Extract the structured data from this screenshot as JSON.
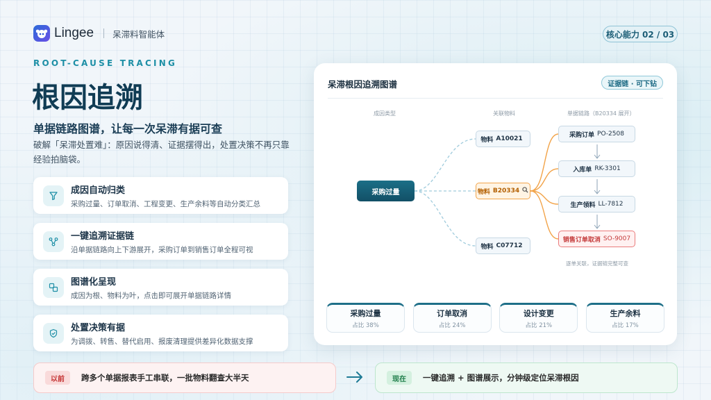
{
  "header": {
    "brand": "Lingee",
    "product": "呆滞料智能体",
    "page_badge": "核心能力 02 / 03"
  },
  "hero": {
    "eyebrow": "ROOT-CAUSE TRACING",
    "title": "根因追溯",
    "subtitle": "单据链路图谱，让每一次呆滞有据可查",
    "description": "破解「呆滞处置难」：原因说得清、证据摆得出，处置决策不再只靠经验拍脑袋。"
  },
  "features": [
    {
      "icon": "funnel-icon",
      "title": "成因自动归类",
      "desc": "采购过量、订单取消、工程变更、生产余料等自动分类汇总"
    },
    {
      "icon": "share-nodes-icon",
      "title": "一键追溯证据链",
      "desc": "沿单据链路向上下游展开，采购订单到销售订单全程可视"
    },
    {
      "icon": "copy-squares-icon",
      "title": "图谱化呈现",
      "desc": "成因为根、物料为叶，点击即可展开单据链路详情"
    },
    {
      "icon": "shield-check-icon",
      "title": "处置决策有据",
      "desc": "为调拨、转售、替代启用、报废清理提供差异化数据支撑"
    }
  ],
  "graph": {
    "title": "呆滞根因追溯图谱",
    "badge": "证据链 · 可下钻",
    "col_headers": [
      "成因类型",
      "关联物料",
      "单据链路（B20334 展开）"
    ],
    "root": "采购过量",
    "materials": [
      {
        "label": "物料",
        "code": "A10021"
      },
      {
        "label": "物料",
        "code": "B20334"
      },
      {
        "label": "物料",
        "code": "C07712"
      }
    ],
    "chain": [
      {
        "type": "采购订单",
        "code": "PO-2508"
      },
      {
        "type": "入库单",
        "code": "RK-3301"
      },
      {
        "type": "生产领料",
        "code": "LL-7812"
      },
      {
        "type": "销售订单取消",
        "code": "SO-9007"
      }
    ],
    "footnote": "逐单关联，证据链完整可查",
    "accent": "#f2a44a",
    "alert": "#ea7b7b"
  },
  "stats": [
    {
      "name": "采购过量",
      "value": "占比 38%"
    },
    {
      "name": "订单取消",
      "value": "占比 24%"
    },
    {
      "name": "设计变更",
      "value": "占比 21%"
    },
    {
      "name": "生产余料",
      "value": "占比 17%"
    }
  ],
  "comparison": {
    "before_tag": "以前",
    "before_text": "跨多个单据报表手工串联，一批物料翻查大半天",
    "after_tag": "现在",
    "after_text": "一键追溯 + 图谱展示，分钟级定位呆滞根因"
  }
}
